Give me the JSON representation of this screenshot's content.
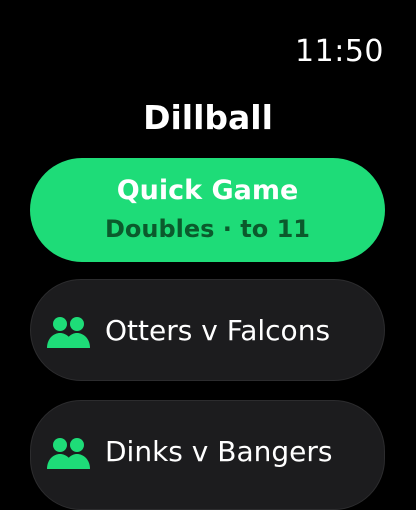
{
  "status": {
    "time": "11:50"
  },
  "app": {
    "title": "Dillball"
  },
  "quick_game": {
    "title": "Quick Game",
    "subtitle": "Doubles · to 11",
    "accent_color": "#1edc78"
  },
  "matches": [
    {
      "label": "Otters v Falcons",
      "icon": "people-icon"
    },
    {
      "label": "Dinks v Bangers",
      "icon": "people-icon"
    }
  ]
}
